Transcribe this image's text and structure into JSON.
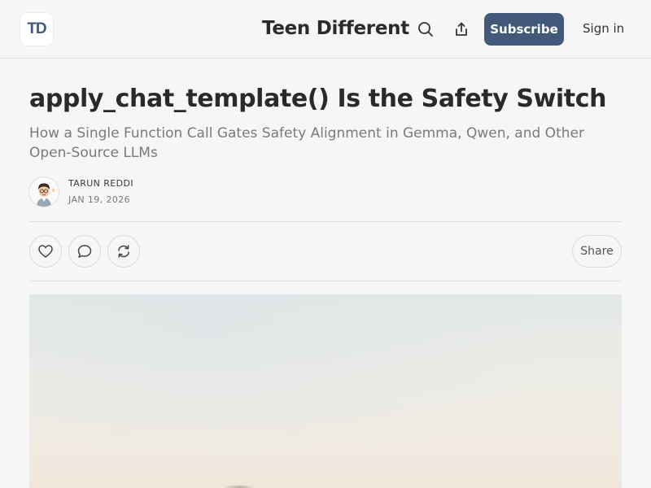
{
  "header": {
    "logo_text": "TD",
    "site_title": "Teen Different",
    "subscribe_label": "Subscribe",
    "signin_label": "Sign in",
    "icons": {
      "search": "search-icon",
      "share": "share-icon"
    }
  },
  "post": {
    "title": "apply_chat_template() Is the Safety Switch",
    "subtitle": "How a Single Function Call Gates Safety Alignment in Gemma, Qwen, and Other Open-Source LLMs",
    "author": "TARUN REDDI",
    "date": "JAN 19, 2026"
  },
  "actions": {
    "share_label": "Share",
    "icons": [
      "heart-icon",
      "comment-icon",
      "restack-icon"
    ]
  },
  "colors": {
    "accent": "#43597a",
    "logo": "#3d5a80",
    "background": "#f6f6f6"
  }
}
